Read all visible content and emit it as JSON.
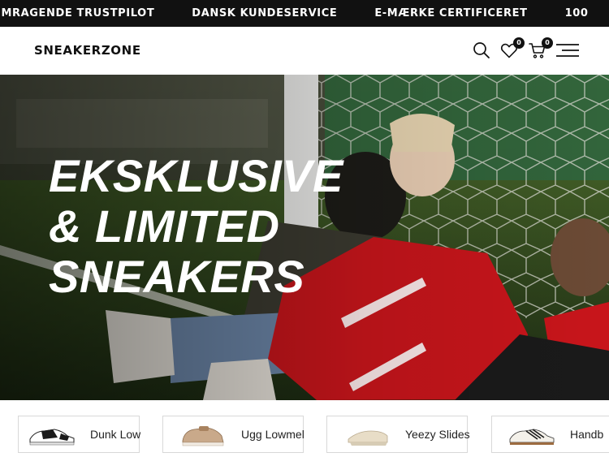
{
  "marquee": {
    "items": [
      "EMRAGENDE TRUSTPILOT",
      "DANSK KUNDESERVICE",
      "E-MÆRKE CERTIFICERET",
      "100"
    ]
  },
  "header": {
    "logo": "SNEAKERZONE",
    "wishlist_count": "0",
    "cart_count": "0"
  },
  "hero": {
    "heading_lines": [
      "EKSKLUSIVE",
      "& LIMITED",
      "SNEAKERS"
    ]
  },
  "categories": [
    {
      "label": "Dunk Low"
    },
    {
      "label": "Ugg Lowmel"
    },
    {
      "label": "Yeezy Slides"
    },
    {
      "label": "Handb"
    }
  ],
  "colors": {
    "accent": "#111111",
    "hero_red": "#c8151b"
  }
}
